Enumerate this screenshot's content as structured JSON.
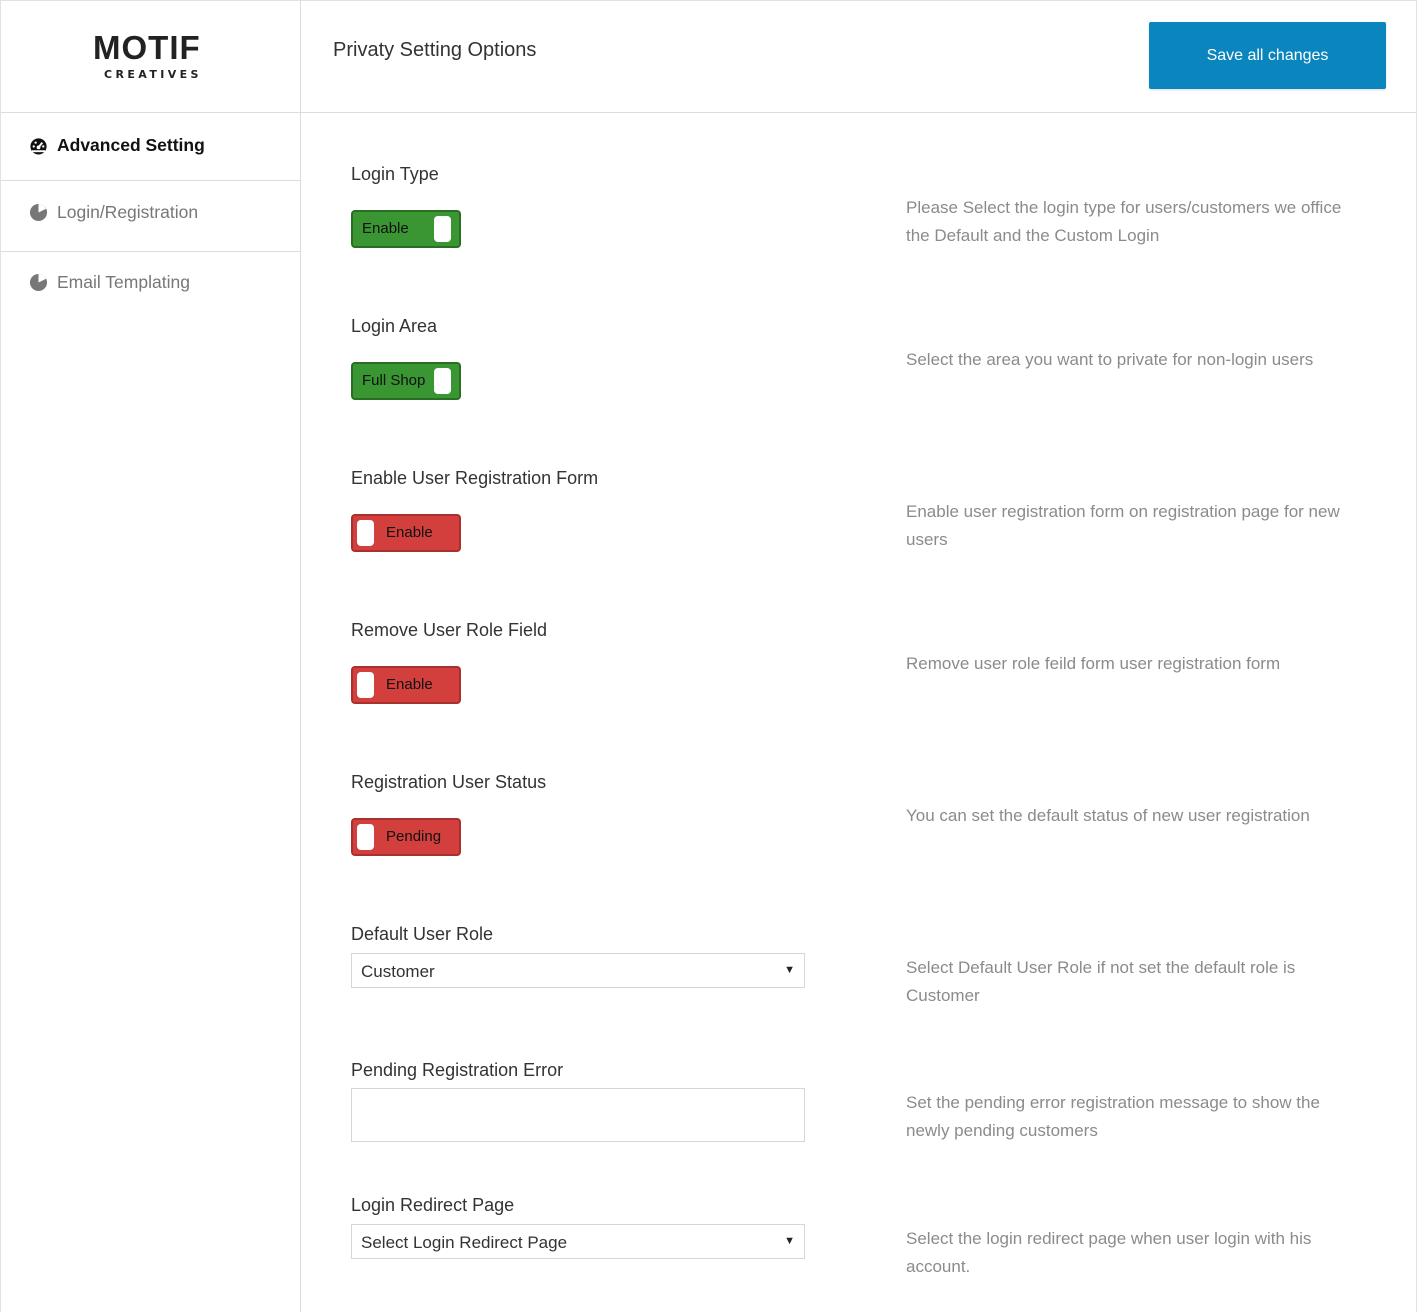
{
  "logo": {
    "name": "MOTIF",
    "sub": "CREATIVES"
  },
  "sidebar": {
    "items": [
      {
        "label": "Advanced Setting",
        "icon": "dashboard-icon"
      },
      {
        "label": "Login/Registration",
        "icon": "pie-chart-icon"
      },
      {
        "label": "Email Templating",
        "icon": "pie-chart-icon"
      }
    ]
  },
  "header": {
    "title": "Privaty Setting Options",
    "save_label": "Save all changes"
  },
  "colors": {
    "accent": "#0a85bd",
    "toggle_on": "#3a9632",
    "toggle_off": "#d23f3c"
  },
  "settings": {
    "login_type": {
      "label": "Login Type",
      "toggle": "Enable",
      "state": "on",
      "desc": "Please Select the login type for users/customers we office the Default and the Custom Login"
    },
    "login_area": {
      "label": "Login Area",
      "toggle": "Full Shop",
      "state": "on",
      "desc": "Select the area you want to private for non-login users"
    },
    "user_reg_form": {
      "label": "Enable User Registration Form",
      "toggle": "Enable",
      "state": "off",
      "desc": "Enable user registration form on registration page for new users"
    },
    "remove_role": {
      "label": "Remove User Role Field",
      "toggle": "Enable",
      "state": "off",
      "desc": "Remove user role feild form user registration form"
    },
    "reg_status": {
      "label": "Registration User Status",
      "toggle": "Pending",
      "state": "off",
      "desc": "You can set the default status of new user registration"
    },
    "default_role": {
      "label": "Default User Role",
      "value": "Customer",
      "desc": "Select Default User Role if not set the default role is Customer"
    },
    "pending_error": {
      "label": "Pending Registration Error",
      "value": "",
      "desc": "Set the pending error registration message to show the newly pending customers"
    },
    "redirect_page": {
      "label": "Login Redirect Page",
      "value": "Select Login Redirect Page",
      "desc": "Select the login redirect page when user login with his account."
    }
  }
}
